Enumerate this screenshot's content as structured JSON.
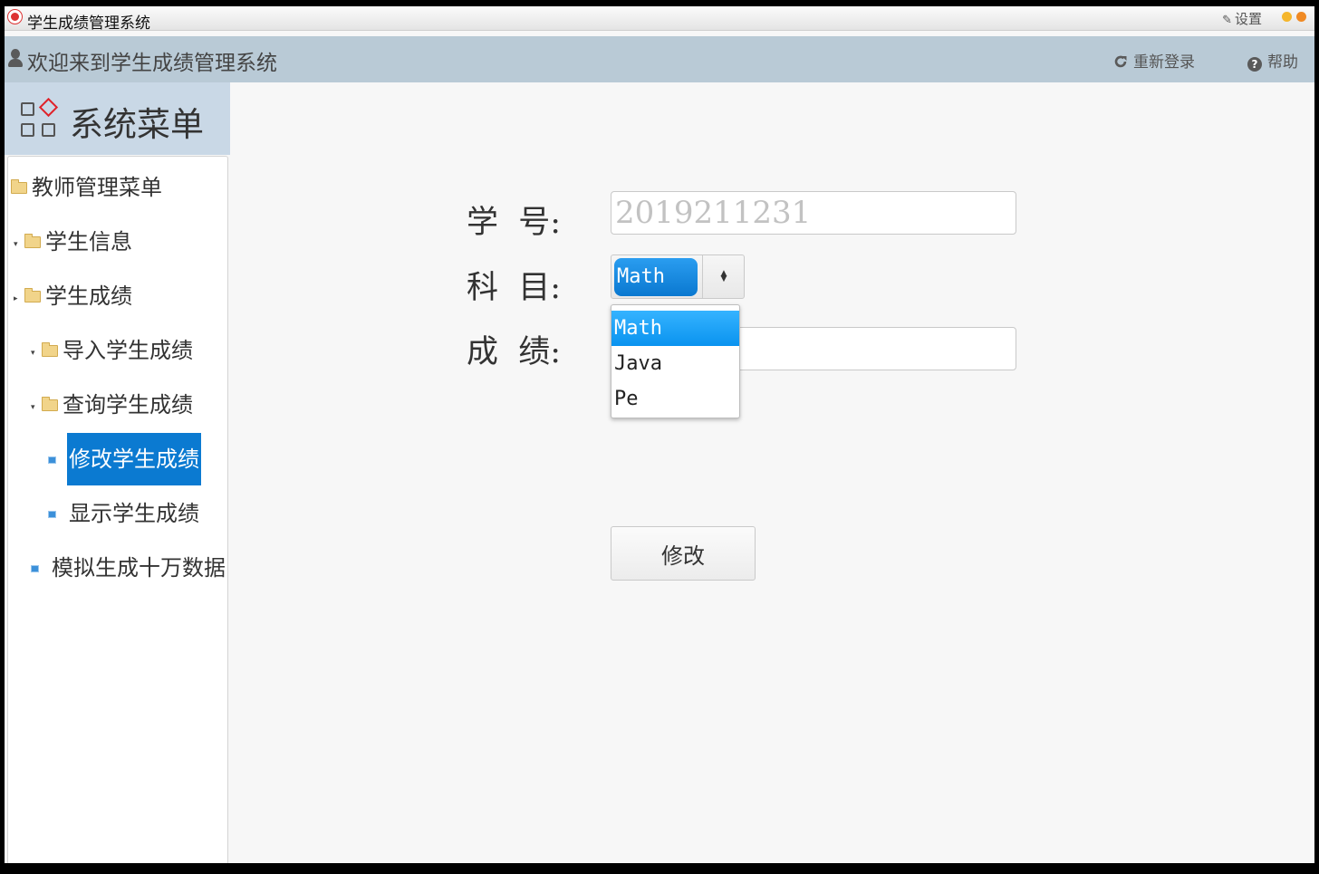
{
  "titlebar": {
    "title": "学生成绩管理系统",
    "settings_label": "设置"
  },
  "header": {
    "welcome": "欢迎来到学生成绩管理系统",
    "relogin_label": "重新登录",
    "help_label": "帮助"
  },
  "menu": {
    "title": "系统菜单",
    "items": [
      {
        "label": "教师管理菜单"
      },
      {
        "label": "学生信息"
      },
      {
        "label": "学生成绩"
      },
      {
        "label": "导入学生成绩"
      },
      {
        "label": "查询学生成绩"
      },
      {
        "label": "修改学生成绩"
      },
      {
        "label": "显示学生成绩"
      },
      {
        "label": "模拟生成十万数据"
      }
    ]
  },
  "form": {
    "id_label": "学  号:",
    "id_placeholder": "2019211231",
    "subject_label": "科  目:",
    "subject_selected": "Math",
    "subject_options": [
      "Math",
      "Java",
      "Pe"
    ],
    "score_label": "成  绩:",
    "score_value": "",
    "submit_label": "修改"
  },
  "colors": {
    "header_bg": "#b9cad6",
    "menu_header_bg": "#c9d8e6",
    "selected": "#0b7ad1"
  }
}
